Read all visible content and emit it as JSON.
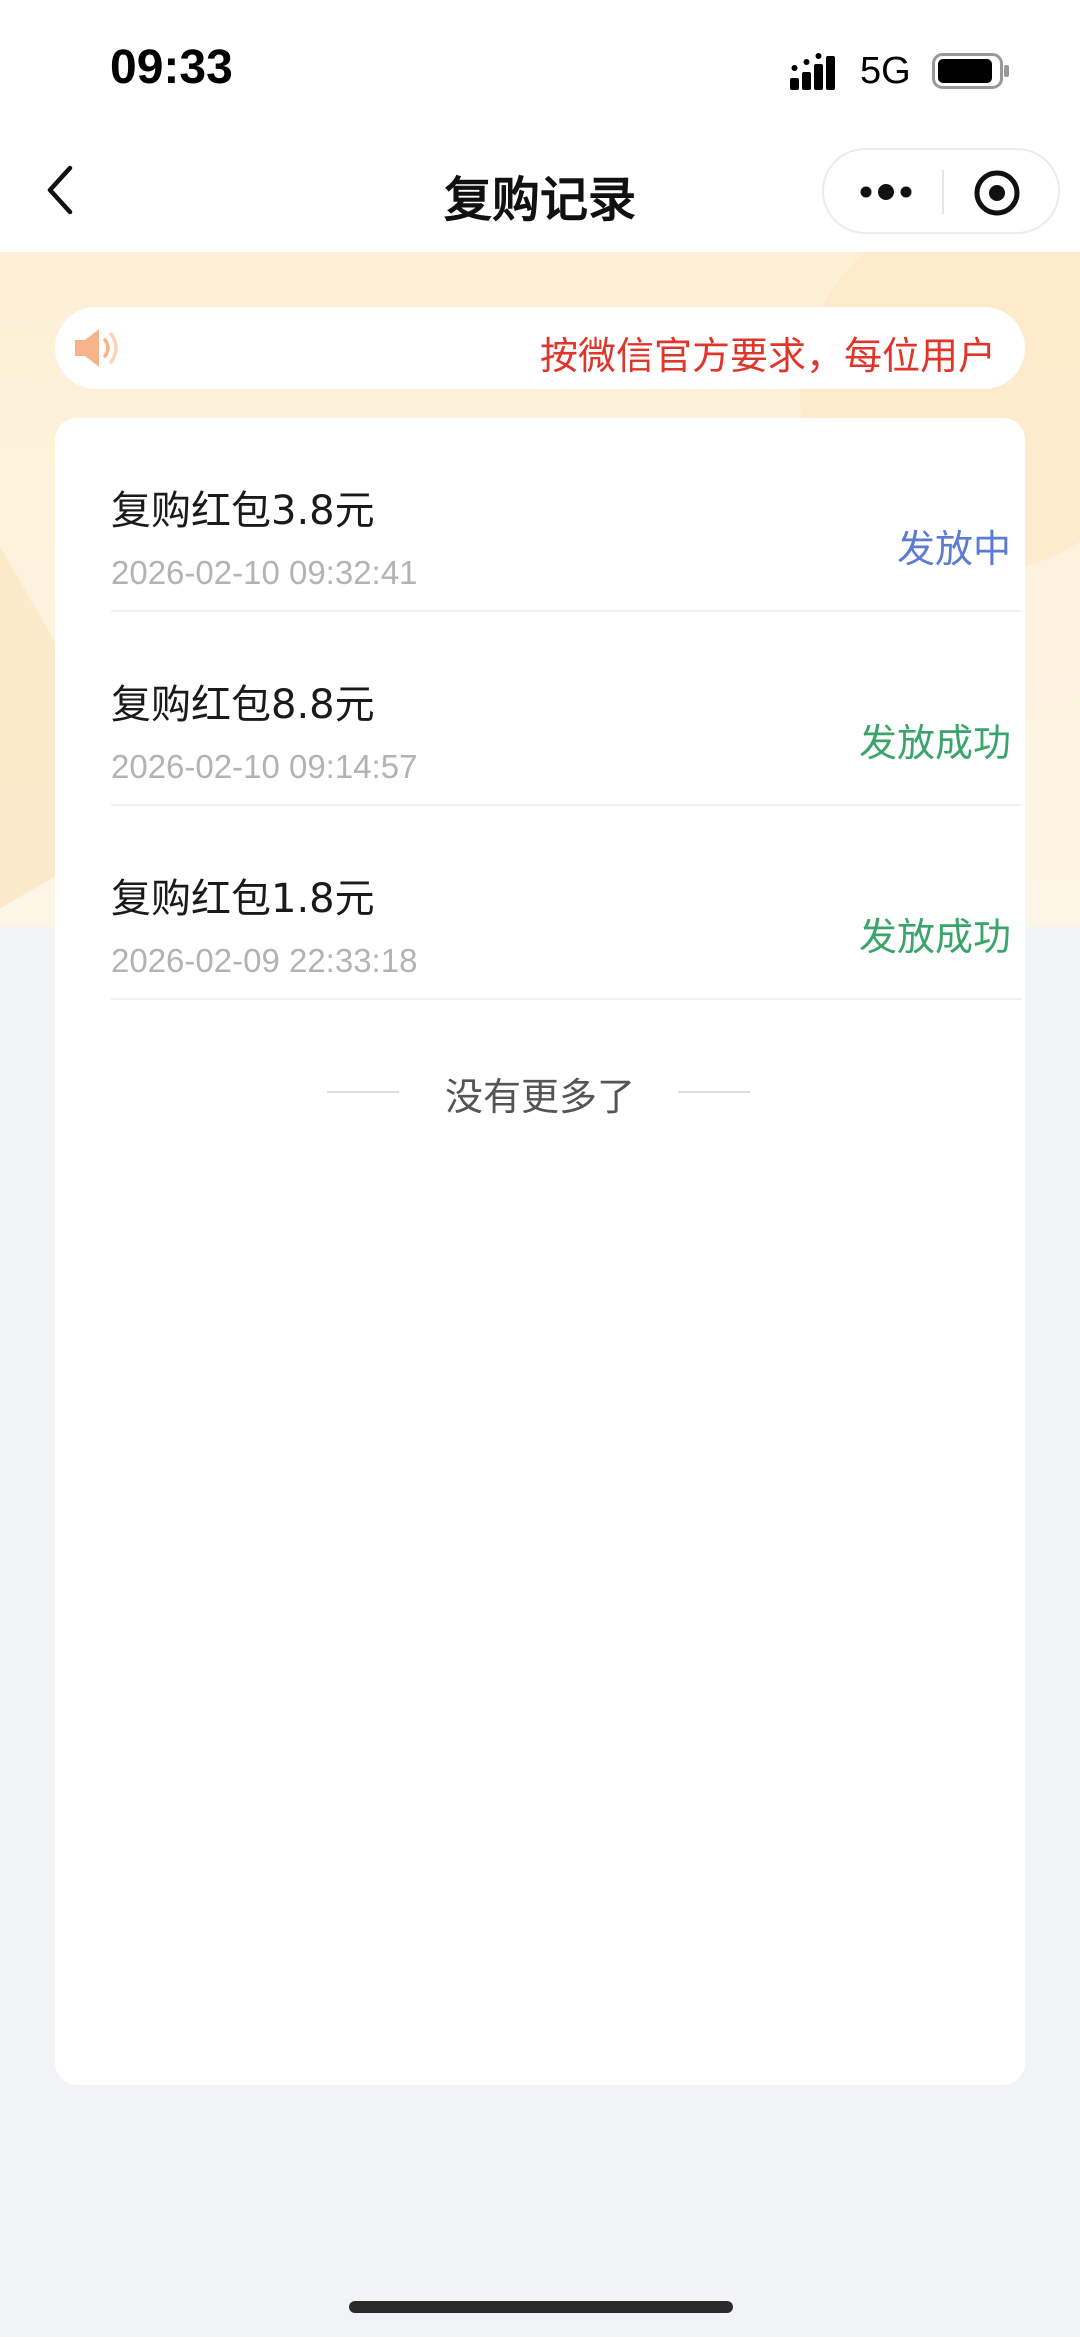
{
  "status_bar": {
    "time": "09:33",
    "network": "5G"
  },
  "nav": {
    "title": "复购记录"
  },
  "notice": {
    "text": "按微信官方要求，每位用户"
  },
  "records": [
    {
      "title": "复购红包3.8元",
      "time": "2026-02-10 09:32:41",
      "status": "发放中",
      "status_color": "#5b7bd5"
    },
    {
      "title": "复购红包8.8元",
      "time": "2026-02-10 09:14:57",
      "status": "发放成功",
      "status_color": "#3aa56b"
    },
    {
      "title": "复购红包1.8元",
      "time": "2026-02-09 22:33:18",
      "status": "发放成功",
      "status_color": "#3aa56b"
    }
  ],
  "end_tip": "没有更多了",
  "colors": {
    "accent_red": "#e0352b",
    "status_pending": "#5b7bd5",
    "status_success": "#3aa56b"
  },
  "icons": [
    "signal-icon",
    "battery-icon",
    "back-icon",
    "more-icon",
    "close-icon",
    "speaker-icon"
  ]
}
